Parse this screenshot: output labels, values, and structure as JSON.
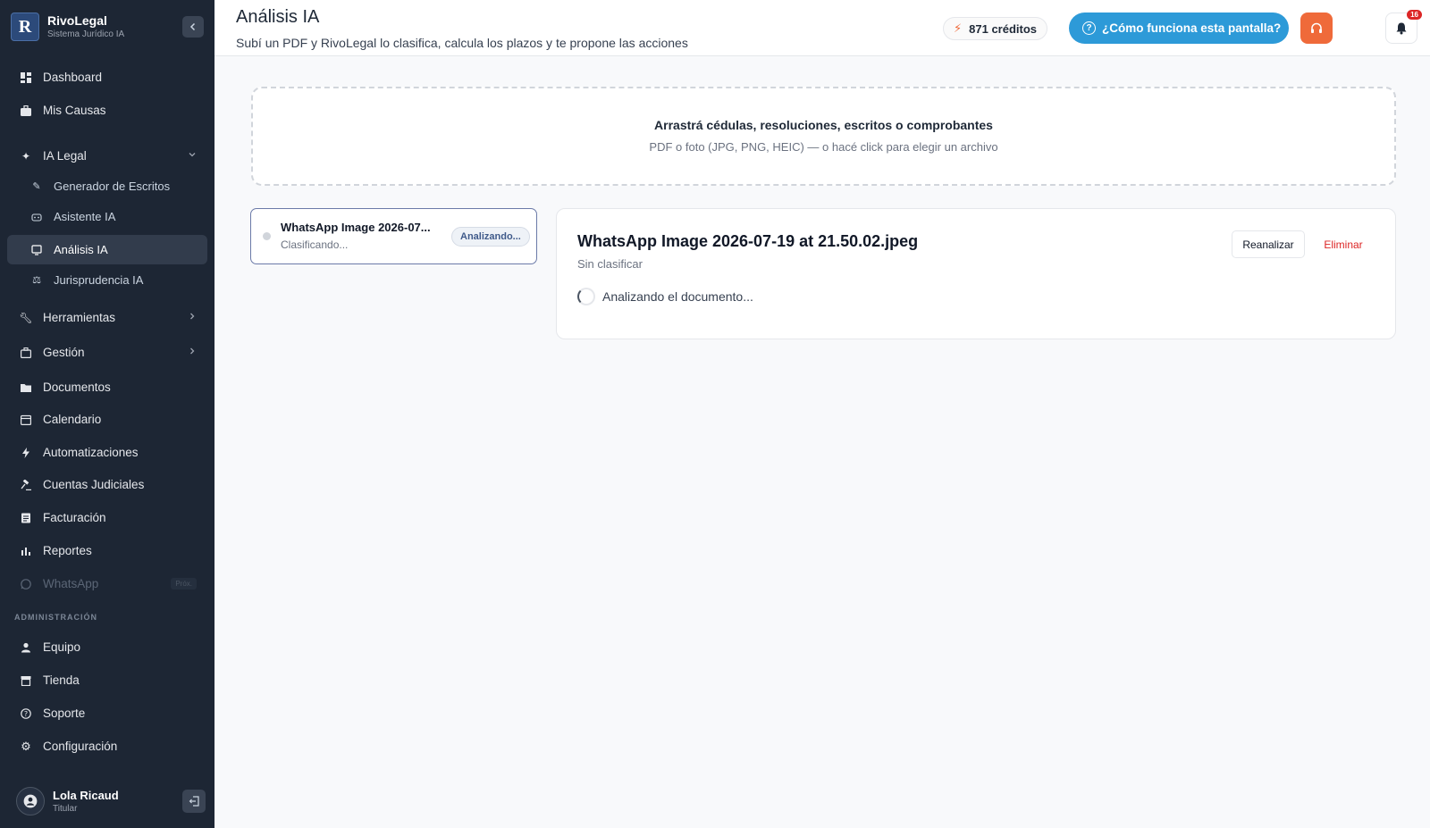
{
  "brand": {
    "name": "RivoLegal",
    "subtitle": "Sistema Jurídico IA",
    "logo_letter": "R"
  },
  "sidebar": {
    "items": [
      {
        "label": "Dashboard",
        "icon": "dashboard-icon"
      },
      {
        "label": "Mis Causas",
        "icon": "briefcase-icon"
      },
      {
        "label": "IA Legal",
        "icon": "sparkles-icon",
        "expanded": true
      },
      {
        "label": "Generador de Escritos",
        "icon": "pen-icon"
      },
      {
        "label": "Asistente IA",
        "icon": "robot-icon"
      },
      {
        "label": "Análisis IA",
        "icon": "monitor-icon",
        "active": true
      },
      {
        "label": "Jurisprudencia IA",
        "icon": "scale-icon"
      },
      {
        "label": "Herramientas",
        "icon": "wrench-icon"
      },
      {
        "label": "Gestión",
        "icon": "briefcase-outline-icon"
      },
      {
        "label": "Documentos",
        "icon": "folder-icon"
      },
      {
        "label": "Calendario",
        "icon": "calendar-icon"
      },
      {
        "label": "Automatizaciones",
        "icon": "bolt-icon"
      },
      {
        "label": "Cuentas Judiciales",
        "icon": "gavel-icon"
      },
      {
        "label": "Facturación",
        "icon": "receipt-icon"
      },
      {
        "label": "Reportes",
        "icon": "bar-chart-icon"
      },
      {
        "label": "WhatsApp",
        "icon": "whatsapp-icon",
        "badge": "Próx."
      }
    ],
    "admin_label": "ADMINISTRACIÓN",
    "admin_items": [
      {
        "label": "Equipo",
        "icon": "user-icon"
      },
      {
        "label": "Tienda",
        "icon": "store-icon"
      },
      {
        "label": "Soporte",
        "icon": "help-circle-icon"
      },
      {
        "label": "Configuración",
        "icon": "gear-icon"
      }
    ]
  },
  "user": {
    "name": "Lola Ricaud",
    "role": "Titular"
  },
  "header": {
    "title": "Análisis IA",
    "subtitle": "Subí un PDF y RivoLegal lo clasifica, calcula los plazos y te propone las acciones",
    "credits": "871 créditos",
    "help_label": "¿Cómo funciona esta pantalla?",
    "notifications_count": "16"
  },
  "dropzone": {
    "title": "Arrastrá cédulas, resoluciones, escritos o comprobantes",
    "subtitle": "PDF o foto (JPG, PNG, HEIC) — o hacé click para elegir un archivo"
  },
  "files": [
    {
      "name": "WhatsApp Image 2026-07...",
      "status": "Clasificando...",
      "badge": "Analizando..."
    }
  ],
  "detail": {
    "title": "WhatsApp Image 2026-07-19 at 21.50.02.jpeg",
    "classification": "Sin clasificar",
    "reanalyze_label": "Reanalizar",
    "delete_label": "Eliminar",
    "progress_text": "Analizando el documento..."
  },
  "colors": {
    "sidebar_bg": "#1d2634",
    "accent_blue": "#2d9ad8",
    "accent_orange": "#ef6a3a",
    "danger": "#dc2626"
  }
}
